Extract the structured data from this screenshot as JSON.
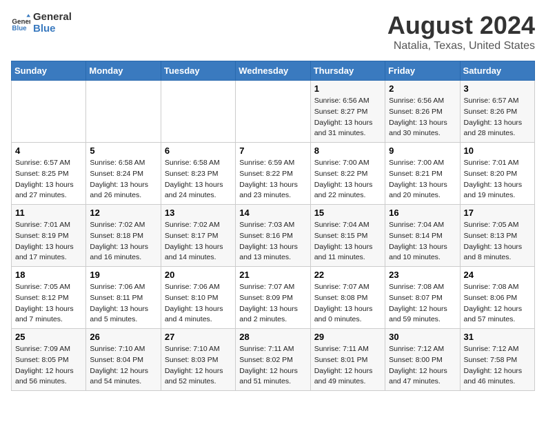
{
  "header": {
    "logo_line1": "General",
    "logo_line2": "Blue",
    "main_title": "August 2024",
    "subtitle": "Natalia, Texas, United States"
  },
  "weekdays": [
    "Sunday",
    "Monday",
    "Tuesday",
    "Wednesday",
    "Thursday",
    "Friday",
    "Saturday"
  ],
  "weeks": [
    [
      {
        "day": "",
        "info": ""
      },
      {
        "day": "",
        "info": ""
      },
      {
        "day": "",
        "info": ""
      },
      {
        "day": "",
        "info": ""
      },
      {
        "day": "1",
        "info": "Sunrise: 6:56 AM\nSunset: 8:27 PM\nDaylight: 13 hours\nand 31 minutes."
      },
      {
        "day": "2",
        "info": "Sunrise: 6:56 AM\nSunset: 8:26 PM\nDaylight: 13 hours\nand 30 minutes."
      },
      {
        "day": "3",
        "info": "Sunrise: 6:57 AM\nSunset: 8:26 PM\nDaylight: 13 hours\nand 28 minutes."
      }
    ],
    [
      {
        "day": "4",
        "info": "Sunrise: 6:57 AM\nSunset: 8:25 PM\nDaylight: 13 hours\nand 27 minutes."
      },
      {
        "day": "5",
        "info": "Sunrise: 6:58 AM\nSunset: 8:24 PM\nDaylight: 13 hours\nand 26 minutes."
      },
      {
        "day": "6",
        "info": "Sunrise: 6:58 AM\nSunset: 8:23 PM\nDaylight: 13 hours\nand 24 minutes."
      },
      {
        "day": "7",
        "info": "Sunrise: 6:59 AM\nSunset: 8:22 PM\nDaylight: 13 hours\nand 23 minutes."
      },
      {
        "day": "8",
        "info": "Sunrise: 7:00 AM\nSunset: 8:22 PM\nDaylight: 13 hours\nand 22 minutes."
      },
      {
        "day": "9",
        "info": "Sunrise: 7:00 AM\nSunset: 8:21 PM\nDaylight: 13 hours\nand 20 minutes."
      },
      {
        "day": "10",
        "info": "Sunrise: 7:01 AM\nSunset: 8:20 PM\nDaylight: 13 hours\nand 19 minutes."
      }
    ],
    [
      {
        "day": "11",
        "info": "Sunrise: 7:01 AM\nSunset: 8:19 PM\nDaylight: 13 hours\nand 17 minutes."
      },
      {
        "day": "12",
        "info": "Sunrise: 7:02 AM\nSunset: 8:18 PM\nDaylight: 13 hours\nand 16 minutes."
      },
      {
        "day": "13",
        "info": "Sunrise: 7:02 AM\nSunset: 8:17 PM\nDaylight: 13 hours\nand 14 minutes."
      },
      {
        "day": "14",
        "info": "Sunrise: 7:03 AM\nSunset: 8:16 PM\nDaylight: 13 hours\nand 13 minutes."
      },
      {
        "day": "15",
        "info": "Sunrise: 7:04 AM\nSunset: 8:15 PM\nDaylight: 13 hours\nand 11 minutes."
      },
      {
        "day": "16",
        "info": "Sunrise: 7:04 AM\nSunset: 8:14 PM\nDaylight: 13 hours\nand 10 minutes."
      },
      {
        "day": "17",
        "info": "Sunrise: 7:05 AM\nSunset: 8:13 PM\nDaylight: 13 hours\nand 8 minutes."
      }
    ],
    [
      {
        "day": "18",
        "info": "Sunrise: 7:05 AM\nSunset: 8:12 PM\nDaylight: 13 hours\nand 7 minutes."
      },
      {
        "day": "19",
        "info": "Sunrise: 7:06 AM\nSunset: 8:11 PM\nDaylight: 13 hours\nand 5 minutes."
      },
      {
        "day": "20",
        "info": "Sunrise: 7:06 AM\nSunset: 8:10 PM\nDaylight: 13 hours\nand 4 minutes."
      },
      {
        "day": "21",
        "info": "Sunrise: 7:07 AM\nSunset: 8:09 PM\nDaylight: 13 hours\nand 2 minutes."
      },
      {
        "day": "22",
        "info": "Sunrise: 7:07 AM\nSunset: 8:08 PM\nDaylight: 13 hours\nand 0 minutes."
      },
      {
        "day": "23",
        "info": "Sunrise: 7:08 AM\nSunset: 8:07 PM\nDaylight: 12 hours\nand 59 minutes."
      },
      {
        "day": "24",
        "info": "Sunrise: 7:08 AM\nSunset: 8:06 PM\nDaylight: 12 hours\nand 57 minutes."
      }
    ],
    [
      {
        "day": "25",
        "info": "Sunrise: 7:09 AM\nSunset: 8:05 PM\nDaylight: 12 hours\nand 56 minutes."
      },
      {
        "day": "26",
        "info": "Sunrise: 7:10 AM\nSunset: 8:04 PM\nDaylight: 12 hours\nand 54 minutes."
      },
      {
        "day": "27",
        "info": "Sunrise: 7:10 AM\nSunset: 8:03 PM\nDaylight: 12 hours\nand 52 minutes."
      },
      {
        "day": "28",
        "info": "Sunrise: 7:11 AM\nSunset: 8:02 PM\nDaylight: 12 hours\nand 51 minutes."
      },
      {
        "day": "29",
        "info": "Sunrise: 7:11 AM\nSunset: 8:01 PM\nDaylight: 12 hours\nand 49 minutes."
      },
      {
        "day": "30",
        "info": "Sunrise: 7:12 AM\nSunset: 8:00 PM\nDaylight: 12 hours\nand 47 minutes."
      },
      {
        "day": "31",
        "info": "Sunrise: 7:12 AM\nSunset: 7:58 PM\nDaylight: 12 hours\nand 46 minutes."
      }
    ]
  ]
}
